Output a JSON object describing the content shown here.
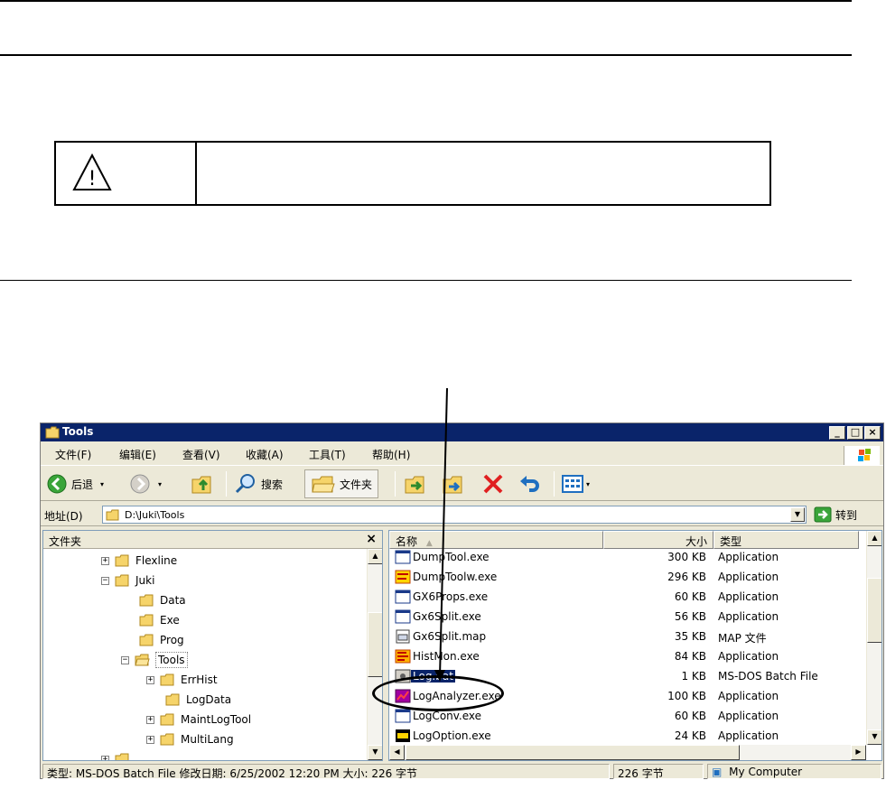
{
  "window": {
    "title": "Tools"
  },
  "menu": [
    "文件(F)",
    "编辑(E)",
    "查看(V)",
    "收藏(A)",
    "工具(T)",
    "帮助(H)"
  ],
  "toolbar": {
    "back_label": "后退",
    "search_label": "搜索",
    "folders_label": "文件夹"
  },
  "address": {
    "label": "地址(D)",
    "value": "D:\\Juki\\Tools",
    "go_label": "转到"
  },
  "folder_pane": {
    "title": "文件夹",
    "close_glyph": "×",
    "items": [
      {
        "label": "Flexline",
        "expander": "+"
      },
      {
        "label": "Juki",
        "expander": "−"
      },
      {
        "label": "Data",
        "expander": ""
      },
      {
        "label": "Exe",
        "expander": ""
      },
      {
        "label": "Prog",
        "expander": ""
      },
      {
        "label": "Tools",
        "expander": "−"
      },
      {
        "label": "ErrHist",
        "expander": "+"
      },
      {
        "label": "LogData",
        "expander": ""
      },
      {
        "label": "MaintLogTool",
        "expander": "+"
      },
      {
        "label": "MultiLang",
        "expander": "+"
      }
    ]
  },
  "file_list": {
    "columns": {
      "name": "名称",
      "size": "大小",
      "type": "类型"
    },
    "rows": [
      {
        "name": "DumpTool.exe",
        "size": "300 KB",
        "type": "Application",
        "icon": "app-window-icon"
      },
      {
        "name": "DumpToolw.exe",
        "size": "296 KB",
        "type": "Application",
        "icon": "dump-tool-icon"
      },
      {
        "name": "GX6Props.exe",
        "size": "60 KB",
        "type": "Application",
        "icon": "app-window-icon"
      },
      {
        "name": "Gx6Split.exe",
        "size": "56 KB",
        "type": "Application",
        "icon": "app-window-icon"
      },
      {
        "name": "Gx6Split.map",
        "size": "35 KB",
        "type": "MAP 文件",
        "icon": "map-file-icon"
      },
      {
        "name": "HistMon.exe",
        "size": "84 KB",
        "type": "Application",
        "icon": "hist-mon-icon"
      },
      {
        "name": "Log.bat",
        "size": "1 KB",
        "type": "MS-DOS Batch File",
        "icon": "batch-file-icon",
        "selected": true
      },
      {
        "name": "LogAnalyzer.exe",
        "size": "100 KB",
        "type": "Application",
        "icon": "log-analyzer-icon"
      },
      {
        "name": "LogConv.exe",
        "size": "60 KB",
        "type": "Application",
        "icon": "app-window-icon"
      },
      {
        "name": "LogOption.exe",
        "size": "24 KB",
        "type": "Application",
        "icon": "log-option-icon"
      }
    ]
  },
  "status": {
    "info": "类型: MS-DOS Batch File 修改日期: 6/25/2002 12:20 PM 大小: 226 字节",
    "size": "226 字节",
    "zone": "My Computer"
  },
  "caution_box": {
    "symbol": "!"
  }
}
